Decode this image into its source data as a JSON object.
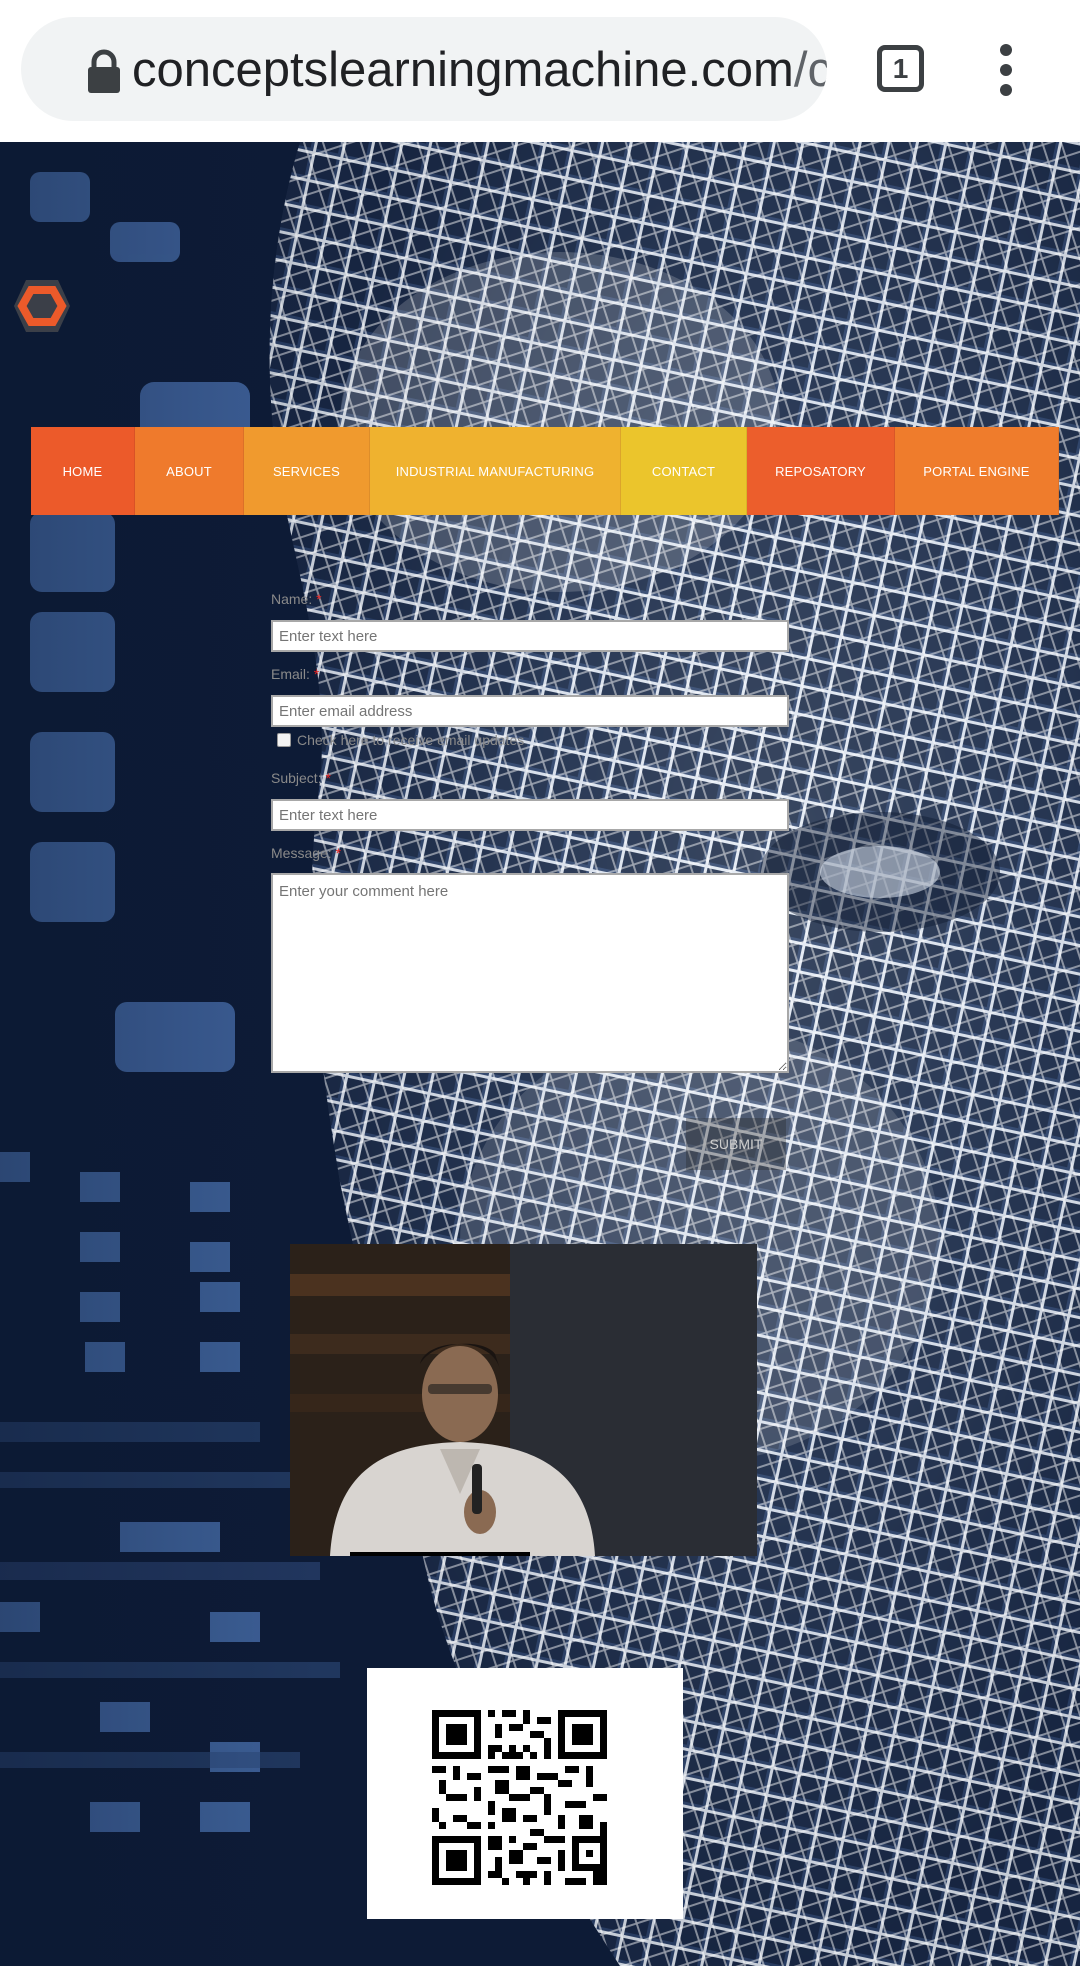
{
  "browser": {
    "url_domain": "conceptslearningmachine.com",
    "url_path": "/c",
    "tab_count": "1",
    "icons": [
      "lock-icon",
      "tabs-icon",
      "overflow-menu-icon"
    ]
  },
  "nav": {
    "items": [
      {
        "label": "HOME",
        "color": "#ec5a2a"
      },
      {
        "label": "ABOUT",
        "color": "#ef7a2c"
      },
      {
        "label": "SERVICES",
        "color": "#f09a2e"
      },
      {
        "label": "INDUSTRIAL MANUFACTURING",
        "color": "#efb22f"
      },
      {
        "label": "CONTACT",
        "color": "#ebc52c"
      },
      {
        "label": "REPOSATORY",
        "color": "#ec5e2c"
      },
      {
        "label": "PORTAL ENGINE",
        "color": "#ef7c2c"
      }
    ]
  },
  "form": {
    "name_label": "Name:",
    "name_placeholder": "Enter text here",
    "email_label": "Email:",
    "email_placeholder": "Enter email address",
    "updates_label": "Check here to receive email updates",
    "subject_label": "Subject:",
    "subject_placeholder": "Enter text here",
    "message_label": "Message:",
    "message_placeholder": "Enter your comment here",
    "required_mark": "*",
    "submit_label": "SUBMIT"
  },
  "colors": {
    "accent_orange": "#ec5a2a",
    "required_red": "#e02020"
  }
}
